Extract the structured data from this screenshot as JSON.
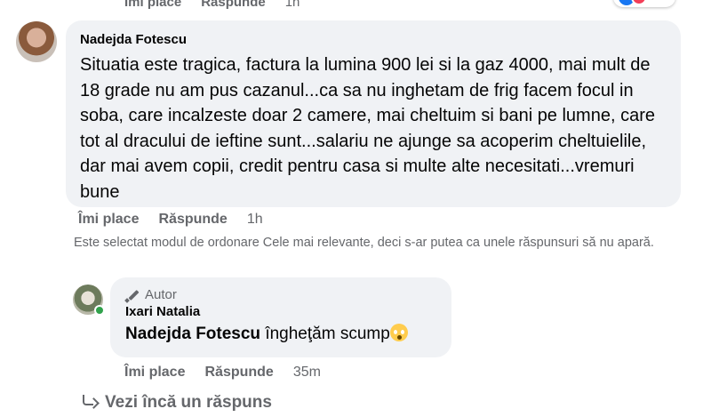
{
  "top_actions": {
    "like": "Îmi place",
    "reply": "Răspunde",
    "time": "1h"
  },
  "comment": {
    "author": "Nadejda Fotescu",
    "text": "Situatia este tragica, factura la lumina 900 lei si la gaz 4000, mai mult de 18 grade nu am pus cazanul...ca sa nu inghetam de frig facem focul in soba, care incalzeste doar 2 camere, mai cheltuim si bani pe lumne, care tot al dracului de ieftine sunt...salariu ne ajunge sa acoperim cheltuielile, dar mai avem copii, credit pentru casa si multe alte necesitati...vremuri bune",
    "actions": {
      "like": "Îmi place",
      "reply": "Răspunde",
      "time": "1h"
    }
  },
  "notice": "Este selectat modul de ordonare Cele mai relevante, deci s-ar putea ca unele răspunsuri să nu apară.",
  "reply": {
    "badge": "Autor",
    "author": "Ixari Natalia",
    "mention": "Nadejda Fotescu",
    "text": " îngheţăm scump",
    "emoji_icon": "flushed-face-icon",
    "actions": {
      "like": "Îmi place",
      "reply": "Răspunde",
      "time": "35m"
    }
  },
  "more_replies": "Vezi încă un răspuns",
  "colors": {
    "bubble": "#f0f2f5",
    "secondary_text": "#65676b",
    "online": "#31a24c"
  }
}
